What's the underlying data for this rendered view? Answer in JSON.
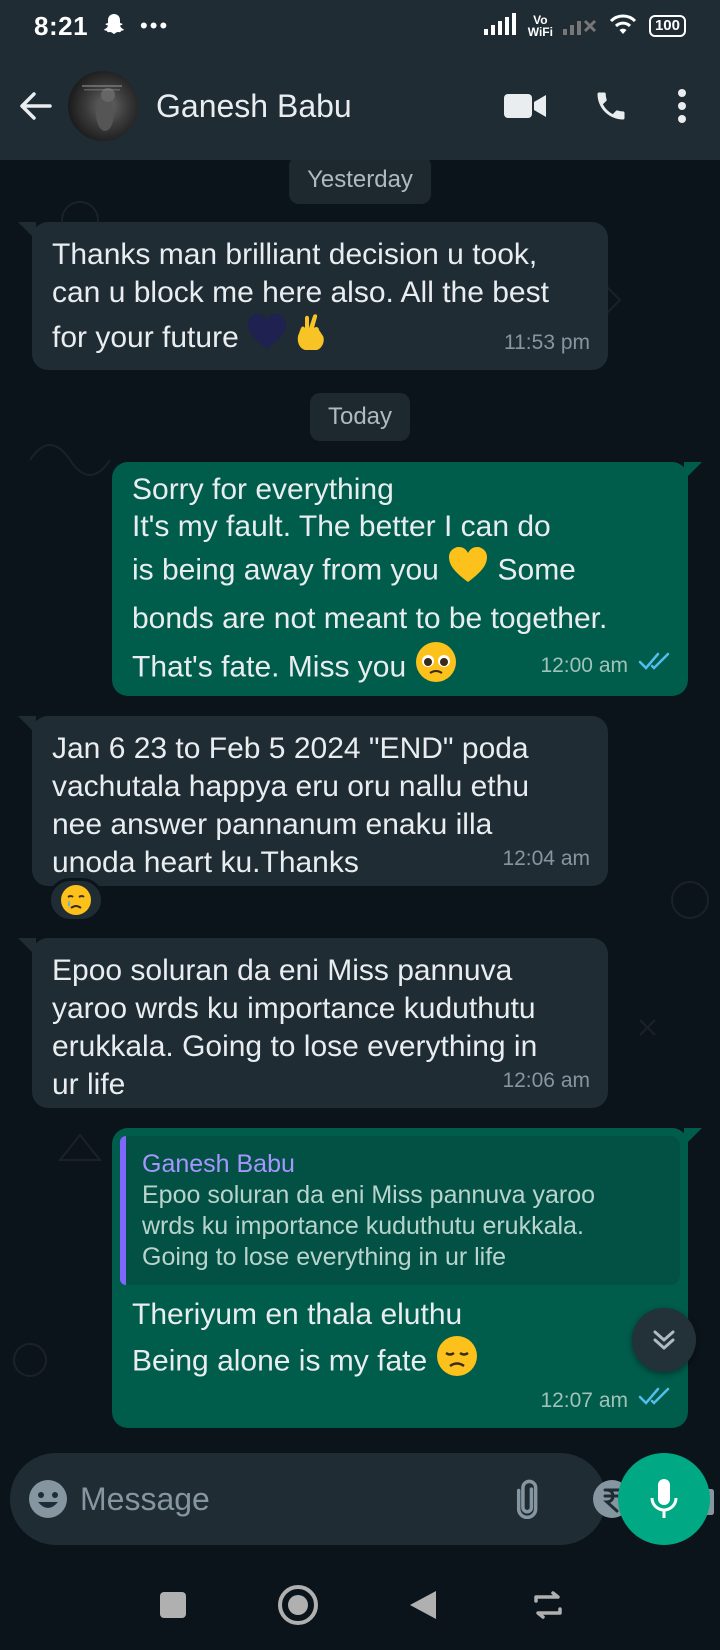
{
  "status_bar": {
    "time": "8:21",
    "vowifi_top": "Vo",
    "vowifi_bottom": "WiFi",
    "battery": "100"
  },
  "header": {
    "contact_name": "Ganesh Babu"
  },
  "chat": {
    "date_yesterday": "Yesterday",
    "date_today": "Today",
    "messages": [
      {
        "direction": "in",
        "line1": "Thanks man brilliant decision u took,",
        "line2": "can u block me here also. All the best",
        "line3": "for your future",
        "time": "11:53 pm"
      },
      {
        "direction": "out",
        "line1": "Sorry for everything",
        "line2": "It's my fault. The better I can do",
        "line3a": "is being away from you",
        "line3b": "Some",
        "line4": "bonds are not meant to be together.",
        "line5": "That's fate. Miss you",
        "time": "12:00 am"
      },
      {
        "direction": "in",
        "line1": "Jan 6 23 to Feb 5 2024 \"END\" poda",
        "line2": "vachutala happya eru oru nallu ethu",
        "line3": "nee answer pannanum enaku illa",
        "line4": "unoda heart ku.Thanks",
        "time": "12:04 am"
      },
      {
        "direction": "in",
        "line1": "Epoo soluran da eni Miss pannuva",
        "line2": "yaroo wrds ku importance kuduthutu",
        "line3": "erukkala. Going to lose everything in",
        "line4": "ur life",
        "time": "12:06 am"
      },
      {
        "direction": "out",
        "quote_author": "Ganesh Babu",
        "quote_line1": "Epoo soluran da eni Miss pannuva yaroo",
        "quote_line2": "wrds ku importance kuduthutu erukkala.",
        "quote_line3": "Going to lose everything in ur life",
        "line1": "Theriyum en thala eluthu",
        "line2": "Being alone is my fate",
        "time": "12:07 am"
      }
    ]
  },
  "input": {
    "placeholder": "Message"
  },
  "icons": {
    "back": "arrow-left-icon",
    "video": "video-call-icon",
    "call": "phone-icon",
    "menu": "more-vert-icon",
    "emoji": "emoji-icon",
    "attach": "paperclip-icon",
    "payment": "rupee-icon",
    "camera": "camera-icon",
    "mic": "mic-icon"
  },
  "colors": {
    "accent": "#00a884",
    "outgoing_bubble": "#005c4b",
    "incoming_bubble": "#1f2c34",
    "read_ticks": "#53bdeb"
  }
}
